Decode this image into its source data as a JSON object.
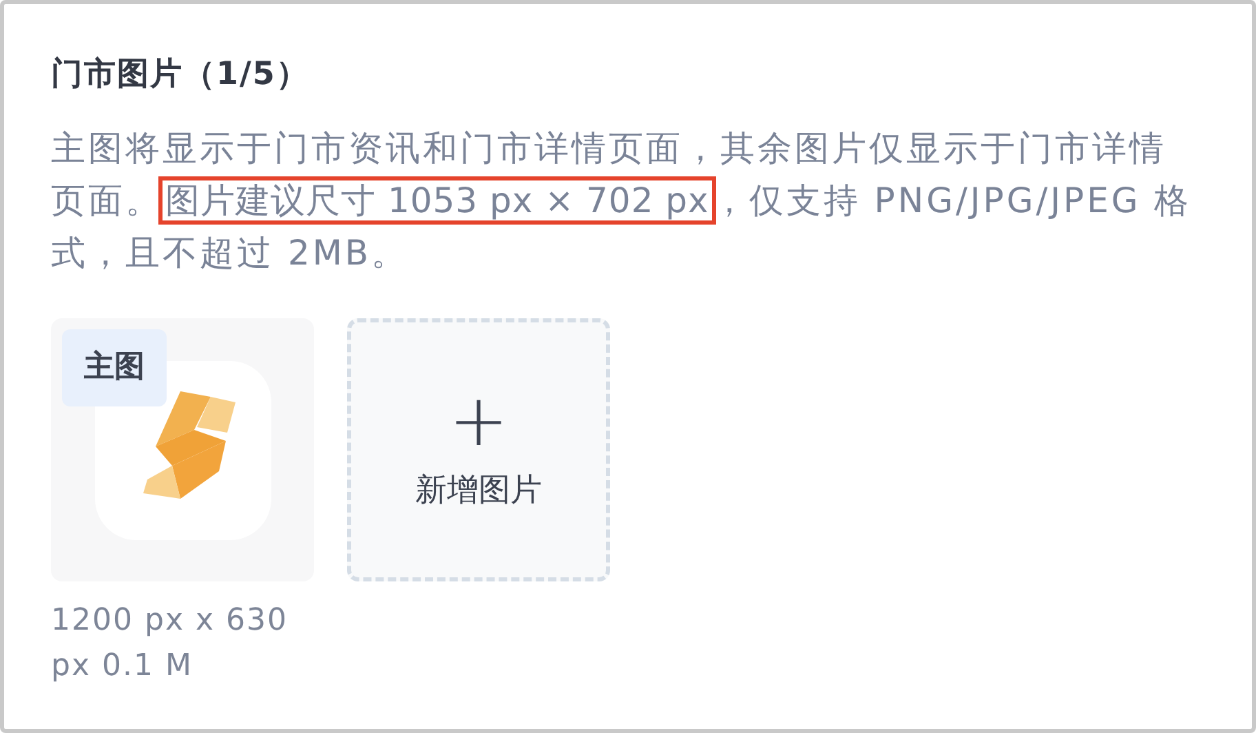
{
  "title": "门市图片（1/5）",
  "description": [
    {
      "text": "主图将显示于门市资讯和门市详情页面，其余图片仅显示于门市详情页面。",
      "highlighted": false
    },
    {
      "text": "图片建议尺寸 1053 px × 702 px",
      "highlighted": true
    },
    {
      "text": "，仅支持 PNG/JPG/JPEG 格式，且不超过 2MB。",
      "highlighted": false
    }
  ],
  "images": [
    {
      "badge": "主图",
      "caption": "1200 px x 630 px 0.1 M"
    }
  ],
  "add_tile": {
    "icon": "+",
    "label": "新增图片"
  }
}
